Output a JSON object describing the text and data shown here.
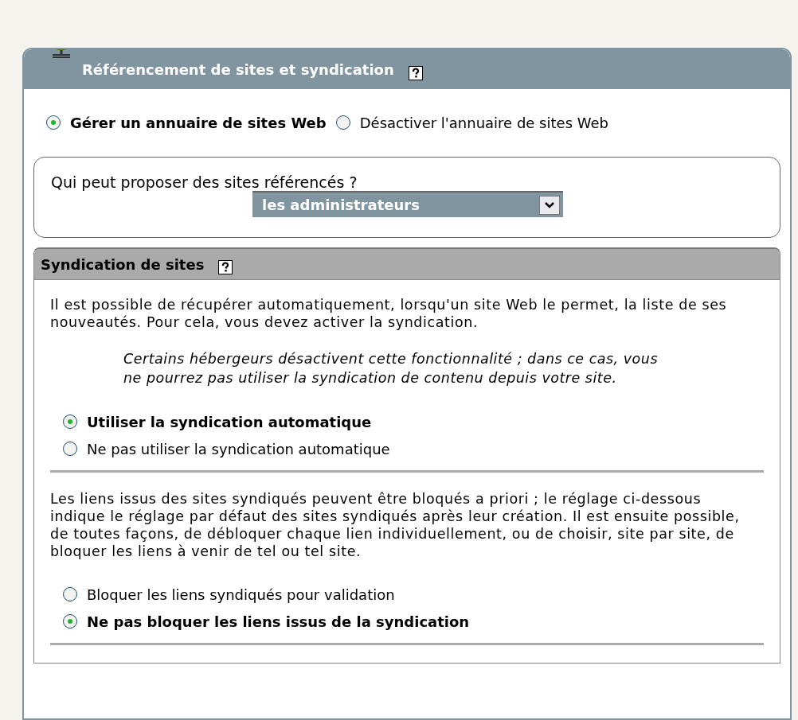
{
  "panel": {
    "title": "Référencement de sites et syndication",
    "directory_options": [
      {
        "label": "Gérer un annuaire de sites Web",
        "selected": true
      },
      {
        "label": "Désactiver l'annuaire de sites Web",
        "selected": false
      }
    ],
    "proposer": {
      "label": "Qui peut proposer des sites référencés ?",
      "value": "les administrateurs"
    },
    "syndication": {
      "title": "Syndication de sites",
      "intro": "Il est possible de récupérer automatiquement, lorsqu'un site Web le permet, la liste de ses nouveautés. Pour cela, vous devez activer la syndication.",
      "note": "Certains hébergeurs désactivent cette fonctionnalité ; dans ce cas, vous ne pourrez pas utiliser la syndication de contenu depuis votre site.",
      "sync_options": [
        {
          "label": "Utiliser la syndication automatique",
          "selected": true
        },
        {
          "label": "Ne pas utiliser la syndication automatique",
          "selected": false
        }
      ],
      "links_text": "Les liens issus des sites syndiqués peuvent être bloqués a priori ; le réglage ci-dessous indique le réglage par défaut des sites syndiqués après leur création. Il est ensuite possible, de toutes façons, de débloquer chaque lien individuellement, ou de choisir, site par site, de bloquer les liens à venir de tel ou tel site.",
      "link_options": [
        {
          "label": "Bloquer les liens syndiqués pour validation",
          "selected": false
        },
        {
          "label": "Ne pas bloquer les liens issus de la syndication",
          "selected": true
        }
      ]
    }
  }
}
